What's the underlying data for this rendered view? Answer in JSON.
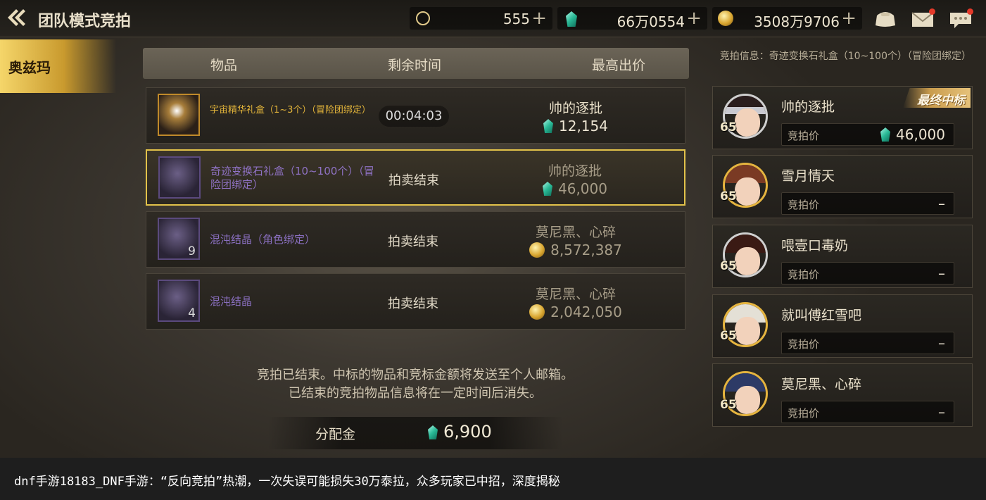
{
  "header": {
    "title": "团队模式竞拍",
    "currencies": [
      {
        "icon": "moon-token-icon",
        "value": "555"
      },
      {
        "icon": "green-gem-icon",
        "value": "66万0554"
      },
      {
        "icon": "gold-coin-icon",
        "value": "3508万9706"
      }
    ],
    "plus": "+"
  },
  "side_tab": {
    "label": "奥兹玛"
  },
  "table": {
    "columns": [
      "物品",
      "剩余时间",
      "最高出价"
    ],
    "rows": [
      {
        "name": "宇宙精华礼盒（1~3个）（冒险团绑定）",
        "count": "",
        "time": "00:04:03",
        "status": "",
        "bidder": "帅的逐批",
        "bid": "12,154",
        "currency": "gem",
        "selected": false
      },
      {
        "name": "奇迹变换石礼盒（10~100个）（冒险团绑定）",
        "count": "",
        "time": "",
        "status": "拍卖结束",
        "bidder": "帅的逐批",
        "bid": "46,000",
        "currency": "gem",
        "selected": true
      },
      {
        "name": "混沌结晶（角色绑定）",
        "count": "9",
        "time": "",
        "status": "拍卖结束",
        "bidder": "莫尼黑、心碎",
        "bid": "8,572,387",
        "currency": "gold",
        "selected": false
      },
      {
        "name": "混沌结晶",
        "count": "4",
        "time": "",
        "status": "拍卖结束",
        "bidder": "莫尼黑、心碎",
        "bid": "2,042,050",
        "currency": "gold",
        "selected": false
      }
    ]
  },
  "notice": {
    "line1": "竞拍已结束。中标的物品和竞标金额将发送至个人邮箱。",
    "line2": "已结束的竞拍物品信息将在一定时间后消失。"
  },
  "allocation": {
    "label": "分配金",
    "value": "6,900"
  },
  "right_panel": {
    "info": "竞拍信息：奇迹变换石礼盒（10~100个）（冒险团绑定）",
    "bid_label": "竞拍价",
    "winner_badge": "最终中标",
    "players": [
      {
        "name": "帅的逐批",
        "level": "65",
        "bid": "46,000"
      },
      {
        "name": "雪月情天",
        "level": "65",
        "bid": "–"
      },
      {
        "name": "喂壹口毒奶",
        "level": "65",
        "bid": "–"
      },
      {
        "name": "就叫傅红雪吧",
        "level": "65",
        "bid": "–"
      },
      {
        "name": "莫尼黑、心碎",
        "level": "65",
        "bid": "–"
      }
    ]
  },
  "caption": "dnf手游18183_DNF手游：“反向竞拍”热潮，一次失误可能损失30万泰拉，众多玩家已中招，深度揭秘",
  "colors": {
    "selected_border": "#e2c24a",
    "item_name_purple": "#a584e0",
    "item_name_gold": "#e2b43a",
    "accent_gem": "#29b996"
  }
}
